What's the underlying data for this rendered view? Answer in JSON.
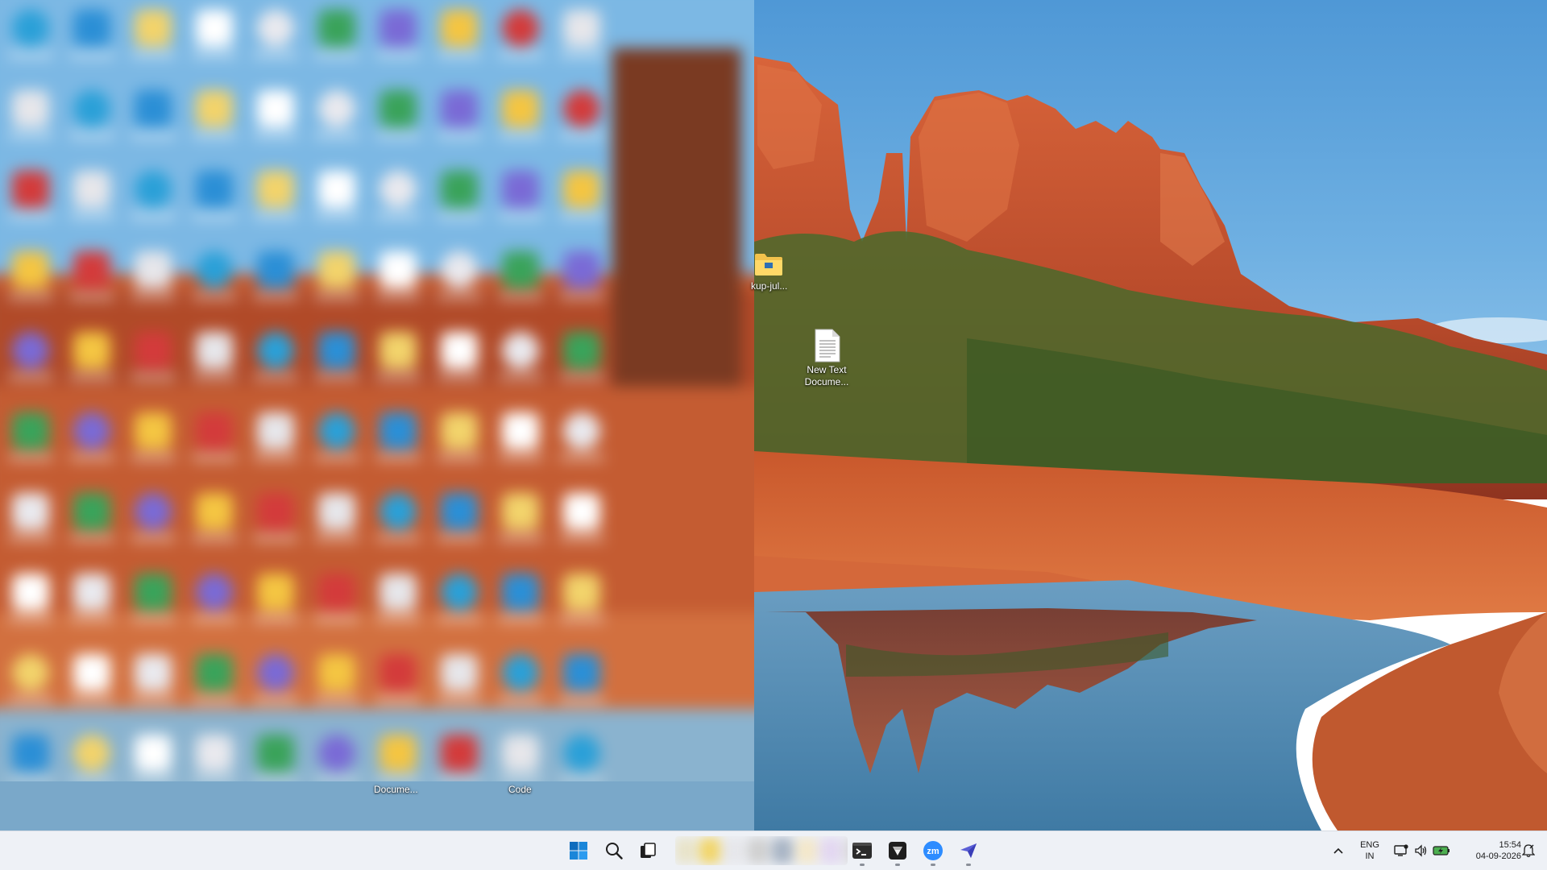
{
  "desktop": {
    "wallpaper": "red-rock-buttes-with-water-reflection",
    "icons": [
      {
        "label": "kup-jul...",
        "icon": "folder-icon"
      },
      {
        "label": "New Text Docume...",
        "label_line1": "New Text",
        "label_line2": "Docume...",
        "icon": "text-document-icon"
      }
    ],
    "visible_labels_in_blur": [
      "Docume...",
      "Code"
    ]
  },
  "taskbar": {
    "items": [
      {
        "name": "start",
        "icon": "windows-logo-icon"
      },
      {
        "name": "search",
        "icon": "search-icon"
      },
      {
        "name": "task-view",
        "icon": "task-view-icon"
      },
      {
        "name": "terminal",
        "icon": "terminal-icon"
      },
      {
        "name": "app",
        "icon": "app-icon"
      },
      {
        "name": "zoom",
        "icon": "zoom-icon",
        "text": "zm"
      },
      {
        "name": "send",
        "icon": "paper-plane-icon"
      }
    ],
    "tray": {
      "language_line1": "ENG",
      "language_line2": "IN",
      "time": "15:54",
      "date": "04-09-2026"
    }
  },
  "colors": {
    "taskbar_bg": "#eef1f6",
    "sky": "#5d9fd6",
    "rock": "#c0522c",
    "windows_blue": "#0f6cbd",
    "zoom_blue": "#2d8cff"
  }
}
